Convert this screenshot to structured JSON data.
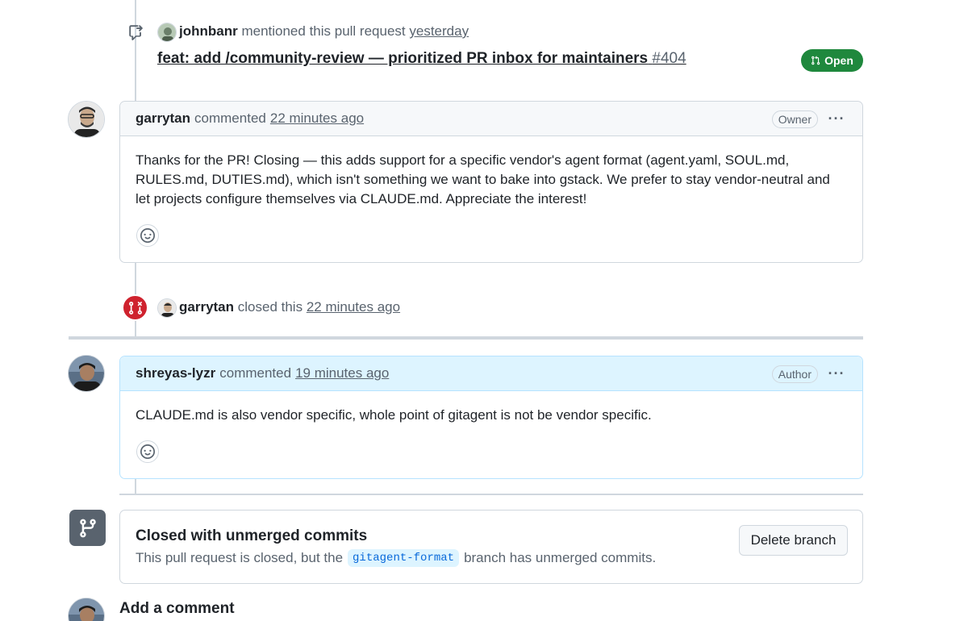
{
  "mention_event": {
    "user": "johnbanr",
    "action": "mentioned this pull request",
    "time": "yesterday",
    "pr_title": "feat: add /community-review — prioritized PR inbox for maintainers",
    "pr_number": "#404",
    "status": "Open",
    "status_color": "#1f883d"
  },
  "comment1": {
    "author": "garrytan",
    "verb": "commented",
    "time": "22 minutes ago",
    "role": "Owner",
    "body": "Thanks for the PR! Closing — this adds support for a specific vendor's agent format (agent.yaml, SOUL.md, RULES.md, DUTIES.md), which isn't something we want to bake into gstack. We prefer to stay vendor-neutral and let projects configure themselves via CLAUDE.md. Appreciate the interest!"
  },
  "close_event": {
    "user": "garrytan",
    "action": "closed this",
    "time": "22 minutes ago",
    "icon_color": "#cf222e"
  },
  "comment2": {
    "author": "shreyas-lyzr",
    "verb": "commented",
    "time": "19 minutes ago",
    "role": "Author",
    "body": "CLAUDE.md is also vendor specific, whole point of gitagent is not be vendor specific."
  },
  "merge_status": {
    "title": "Closed with unmerged commits",
    "text_before": "This pull request is closed, but the",
    "branch": "gitagent-format",
    "text_after": "branch has unmerged commits.",
    "delete_button": "Delete branch"
  },
  "add_comment": {
    "heading": "Add a comment"
  }
}
